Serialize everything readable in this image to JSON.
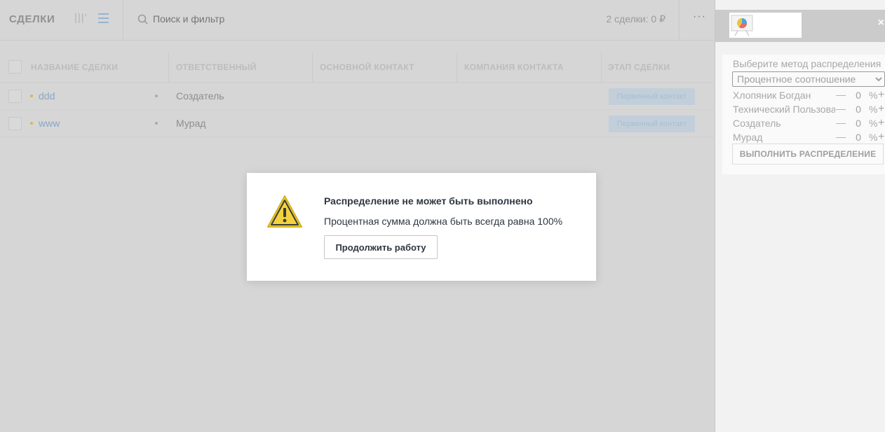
{
  "header": {
    "title": "СДЕЛКИ",
    "view_pipeline_glyph": "|||'",
    "search_placeholder": "Поиск и фильтр",
    "summary": "2 сделки: 0 ₽",
    "more_glyph": "···"
  },
  "table": {
    "columns": [
      "НАЗВАНИЕ СДЕЛКИ",
      "ОТВЕТСТВЕННЫЙ",
      "ОСНОВНОЙ КОНТАКТ",
      "КОМПАНИЯ КОНТАКТА",
      "ЭТАП СДЕЛКИ"
    ],
    "rows": [
      {
        "name": "ddd",
        "responsible": "Создатель",
        "stage": "Первичный контакт"
      },
      {
        "name": "www",
        "responsible": "Мурад",
        "stage": "Первичный контакт"
      }
    ]
  },
  "side_panel": {
    "close_glyph": "×",
    "method_label": "Выберите метод распределения",
    "method_selected": "Процентное соотношение",
    "users": [
      {
        "name": "Хлопяник Богдан",
        "value": "0"
      },
      {
        "name": "Технический Пользователь",
        "value": "0"
      },
      {
        "name": "Создатель",
        "value": "0"
      },
      {
        "name": "Мурад",
        "value": "0"
      }
    ],
    "minus_glyph": "—",
    "plus_glyph": "+",
    "percent_sign": "%",
    "run_button": "ВЫПОЛНИТЬ РАСПРЕДЕЛЕНИЕ"
  },
  "modal": {
    "title": "Распределение не может быть выполнено",
    "message": "Процентная сумма должна быть всегда равна 100%",
    "button": "Продолжить работу",
    "icon": "warning-triangle-icon"
  }
}
